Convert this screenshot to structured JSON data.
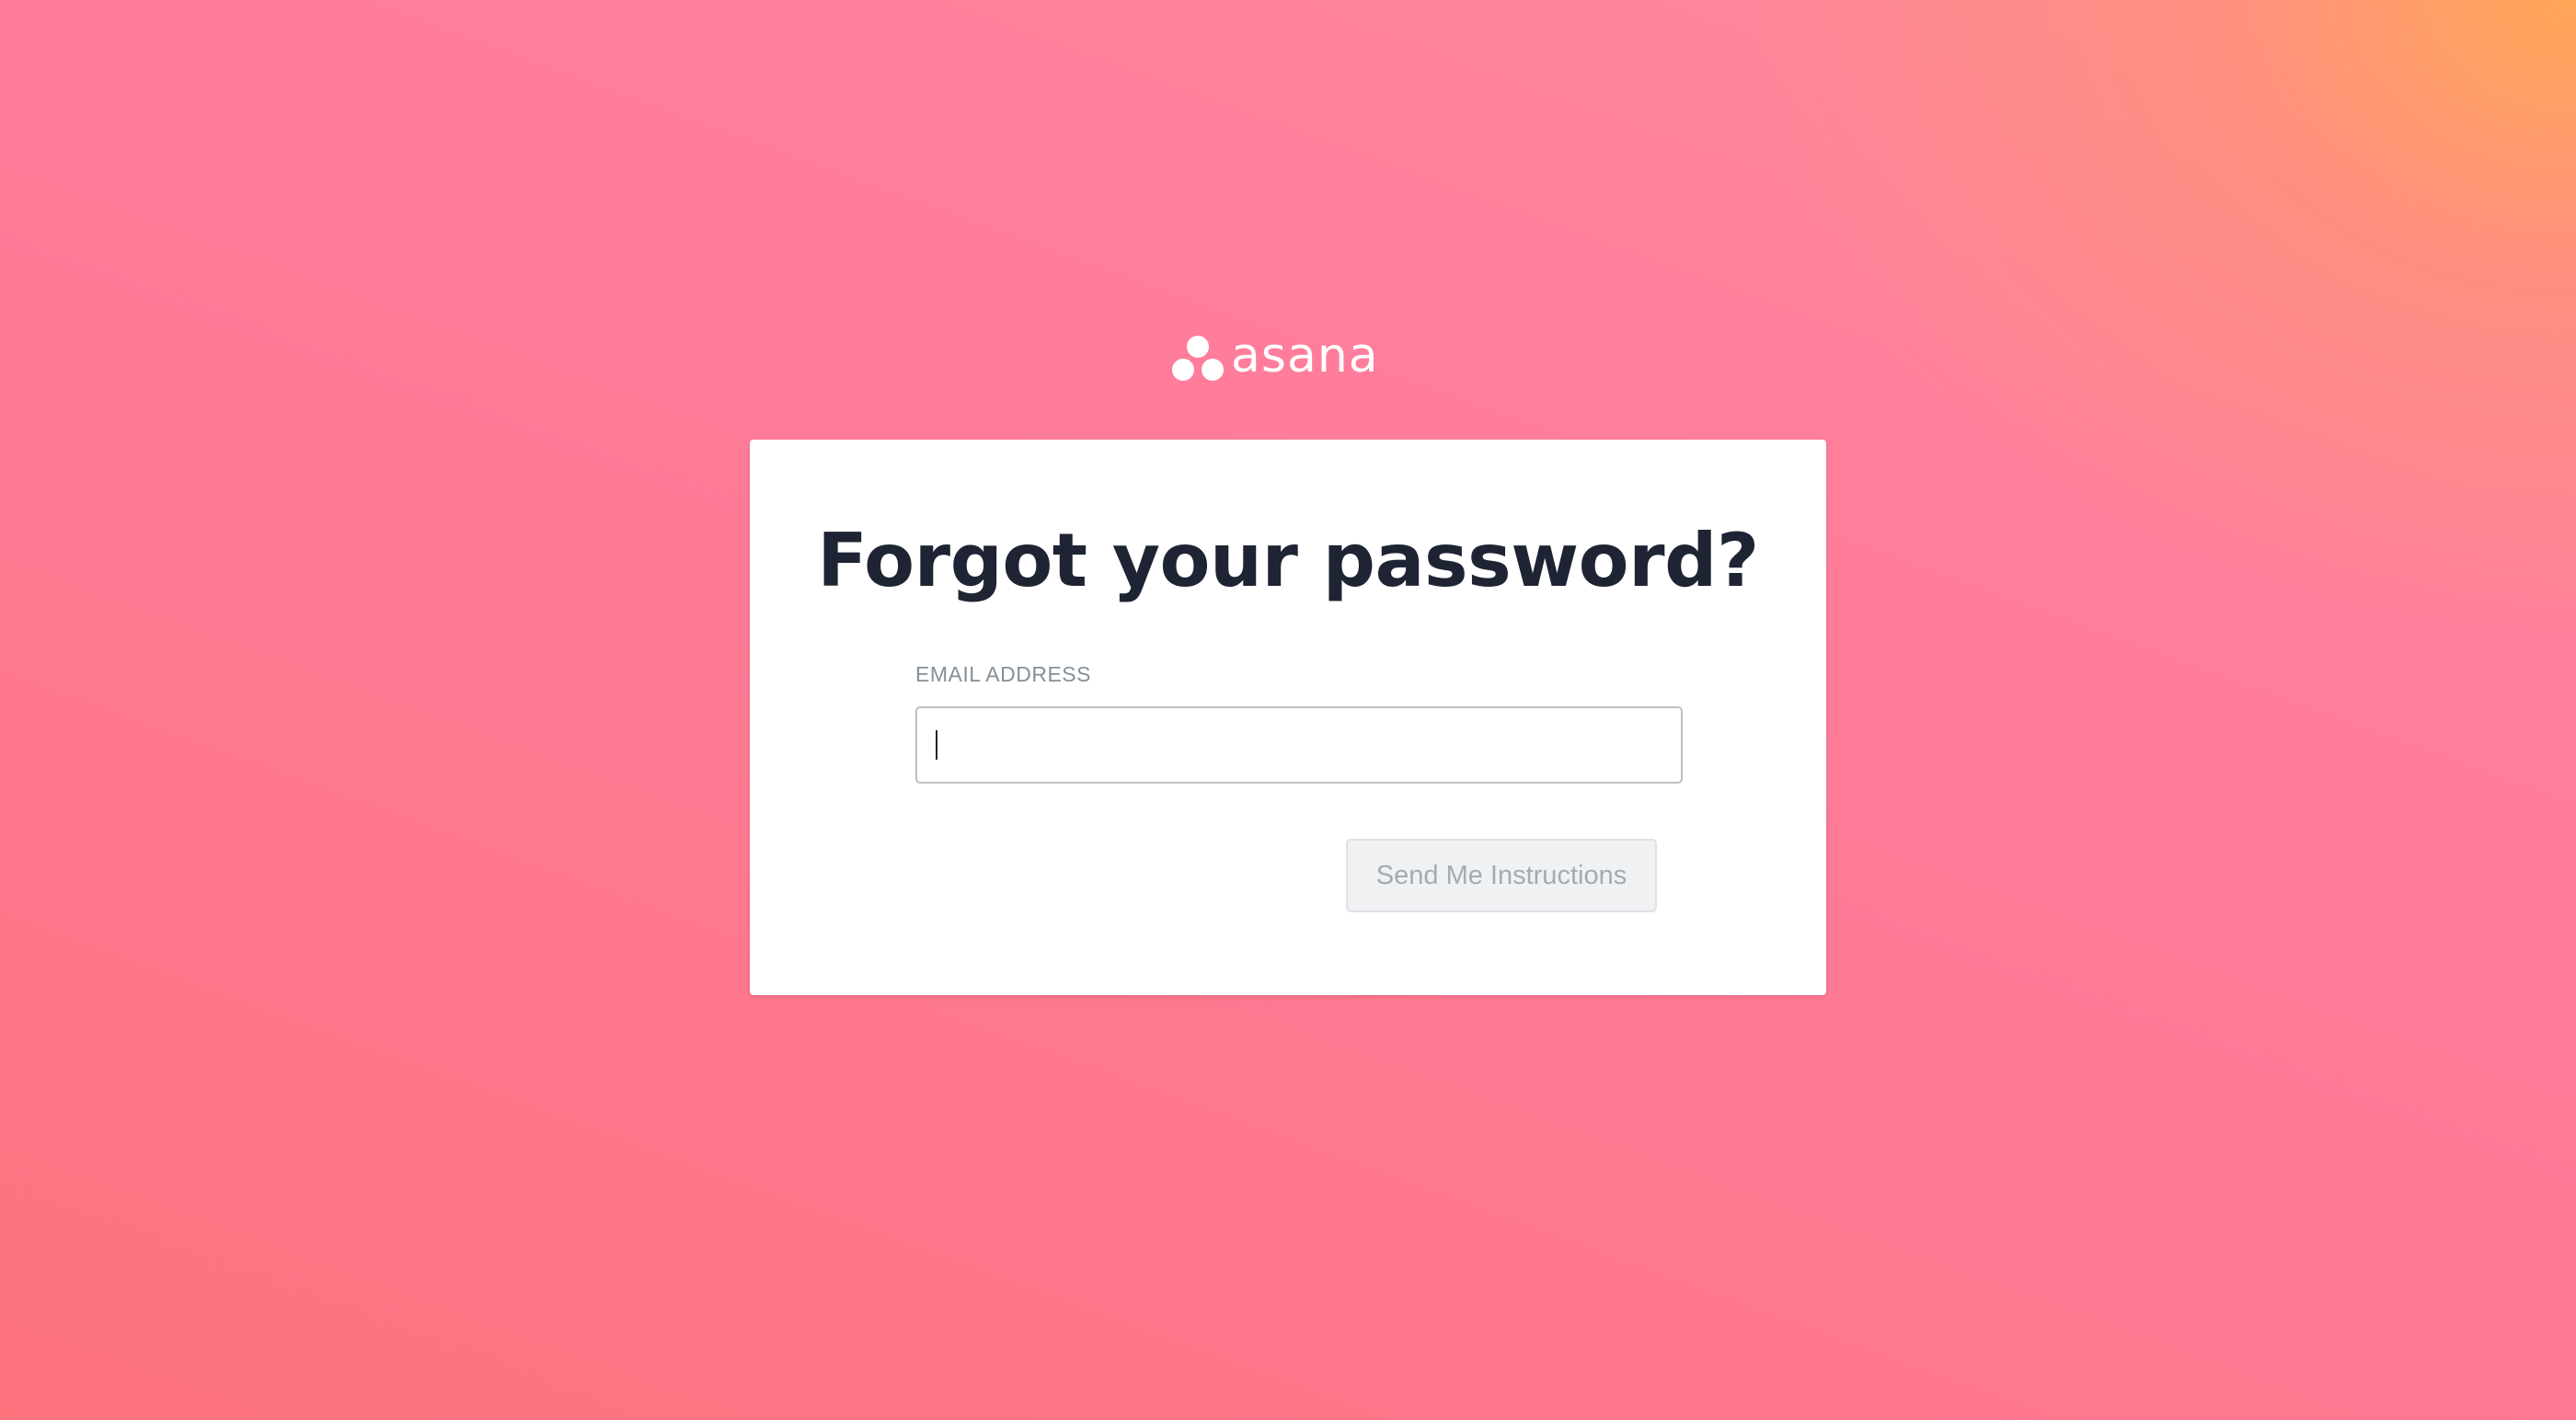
{
  "brand": {
    "name": "asana",
    "logo_icon": "asana-three-dots-icon"
  },
  "card": {
    "title": "Forgot your password?",
    "email_label": "EMAIL ADDRESS",
    "email_value": "",
    "email_placeholder": "",
    "submit_label": "Send Me Instructions",
    "submit_disabled": true
  },
  "colors": {
    "background_gradient_start": "#ff7d9b",
    "background_gradient_corner": "#ffa854",
    "card_background": "#ffffff",
    "title_text": "#1e2433",
    "button_disabled_background": "#f0f1f3",
    "button_disabled_text": "#a3abb3"
  }
}
